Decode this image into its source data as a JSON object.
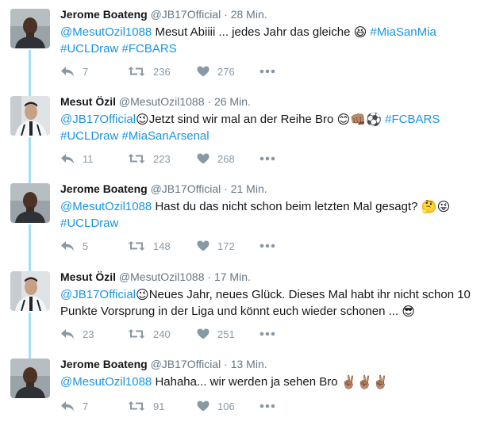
{
  "tweets": [
    {
      "name": "Jerome Boateng",
      "handle": "@JB17Official",
      "time": "28 Min.",
      "replies": "7",
      "retweets": "236",
      "likes": "276",
      "line1": {
        "mention": "@MesutOzil1088",
        "text": " Mesut Abiiii ... jedes Jahr das gleiche ",
        "emoji": "😆",
        "tag": " #MiaSanMia"
      },
      "line2": {
        "tag1": "#UCLDraw",
        "tag2": " #FCBARS"
      }
    },
    {
      "name": "Mesut Özil",
      "handle": "@MesutOzil1088",
      "time": "26 Min.",
      "replies": "11",
      "retweets": "223",
      "likes": "268",
      "line1": {
        "mention": "@JB17Official",
        "emoji1": "😉",
        "text": "Jetzt sind wir mal an der Reihe Bro ",
        "emoji2": "😊👊🏽⚽",
        "tag": " #FCBARS"
      },
      "line2": {
        "tag1": "#UCLDraw",
        "tag2": " #MiaSanArsenal"
      }
    },
    {
      "name": "Jerome Boateng",
      "handle": "@JB17Official",
      "time": "21 Min.",
      "replies": "5",
      "retweets": "148",
      "likes": "172",
      "line1": {
        "mention": "@MesutOzil1088",
        "text": " Hast du das nicht schon beim letzten Mal gesagt? ",
        "emoji": "🤔😜"
      },
      "line2": {
        "tag1": "#UCLDraw"
      }
    },
    {
      "name": "Mesut Özil",
      "handle": "@MesutOzil1088",
      "time": "17 Min.",
      "replies": "23",
      "retweets": "240",
      "likes": "251",
      "line1": {
        "mention": "@JB17Official",
        "emoji1": "😉",
        "text": "Neues Jahr, neues Glück. Dieses Mal habt ihr nicht schon 10"
      },
      "line2": {
        "text": "Punkte Vorsprung in der Liga und könnt euch wieder schonen ... ",
        "emoji": "😎"
      }
    },
    {
      "name": "Jerome Boateng",
      "handle": "@JB17Official",
      "time": "13 Min.",
      "replies": "7",
      "retweets": "91",
      "likes": "106",
      "line1": {
        "mention": "@MesutOzil1088",
        "text": " Hahaha... wir werden ja sehen Bro ",
        "emoji": "✌🏽✌🏽✌🏽"
      }
    }
  ],
  "separator": "·",
  "icons": {
    "reply": "reply-icon",
    "retweet": "retweet-icon",
    "like": "heart-icon",
    "more": "more-dots-icon"
  },
  "colors": {
    "link": "#1b95e0",
    "meta": "#657786",
    "action": "#8899a6",
    "thread_line": "#a5dff1"
  }
}
